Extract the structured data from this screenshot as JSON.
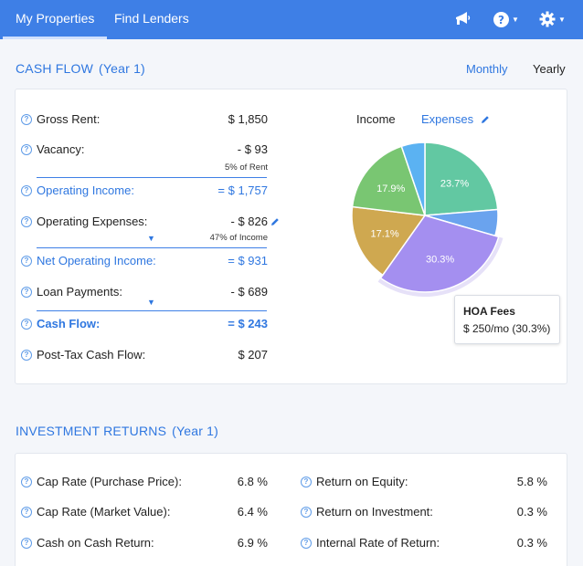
{
  "nav": {
    "tabs": [
      {
        "label": "My Properties",
        "active": true
      },
      {
        "label": "Find Lenders",
        "active": false
      }
    ],
    "icons": [
      "megaphone-icon",
      "help-icon",
      "gear-icon"
    ]
  },
  "cashflow": {
    "title": "CASH FLOW",
    "subtitle": "(Year 1)",
    "toggle": {
      "monthly": "Monthly",
      "yearly": "Yearly"
    },
    "rows": {
      "gross_rent": {
        "label": "Gross Rent:",
        "value": "$ 1,850"
      },
      "vacancy": {
        "label": "Vacancy:",
        "value": "-  $ 93",
        "note": "5% of Rent"
      },
      "operating_income": {
        "label": "Operating Income:",
        "value": "=  $ 1,757"
      },
      "operating_expenses": {
        "label": "Operating Expenses:",
        "value": "-  $ 826",
        "note": "47% of Income"
      },
      "net_operating_income": {
        "label": "Net Operating Income:",
        "value": "=  $ 931"
      },
      "loan_payments": {
        "label": "Loan Payments:",
        "value": "-  $ 689"
      },
      "cash_flow": {
        "label": "Cash Flow:",
        "value": "=  $ 243"
      },
      "post_tax_cash_flow": {
        "label": "Post-Tax Cash Flow:",
        "value": "$ 207"
      }
    },
    "pie": {
      "tabs": {
        "income": "Income",
        "expenses": "Expenses"
      },
      "slices": [
        {
          "value": 23.7,
          "label": "23.7%",
          "color": "#62c8a2"
        },
        {
          "value": 5.8,
          "label": "",
          "color": "#6aa3ee"
        },
        {
          "value": 30.3,
          "label": "30.3%",
          "color": "#a48ff0"
        },
        {
          "value": 17.1,
          "label": "17.1%",
          "color": "#cfa850"
        },
        {
          "value": 17.9,
          "label": "17.9%",
          "color": "#79c672"
        },
        {
          "value": 5.2,
          "label": "",
          "color": "#5bb2f2"
        }
      ],
      "tooltip": {
        "title": "HOA Fees",
        "detail": "$ 250/mo  (30.3%)"
      }
    }
  },
  "investment": {
    "title": "INVESTMENT RETURNS",
    "subtitle": "(Year 1)",
    "left": [
      {
        "label": "Cap Rate (Purchase Price):",
        "value": "6.8 %"
      },
      {
        "label": "Cap Rate (Market Value):",
        "value": "6.4 %"
      },
      {
        "label": "Cash on Cash Return:",
        "value": "6.9 %"
      }
    ],
    "right": [
      {
        "label": "Return on Equity:",
        "value": "5.8 %"
      },
      {
        "label": "Return on Investment:",
        "value": "0.3 %"
      },
      {
        "label": "Internal Rate of Return:",
        "value": "0.3 %"
      }
    ]
  }
}
